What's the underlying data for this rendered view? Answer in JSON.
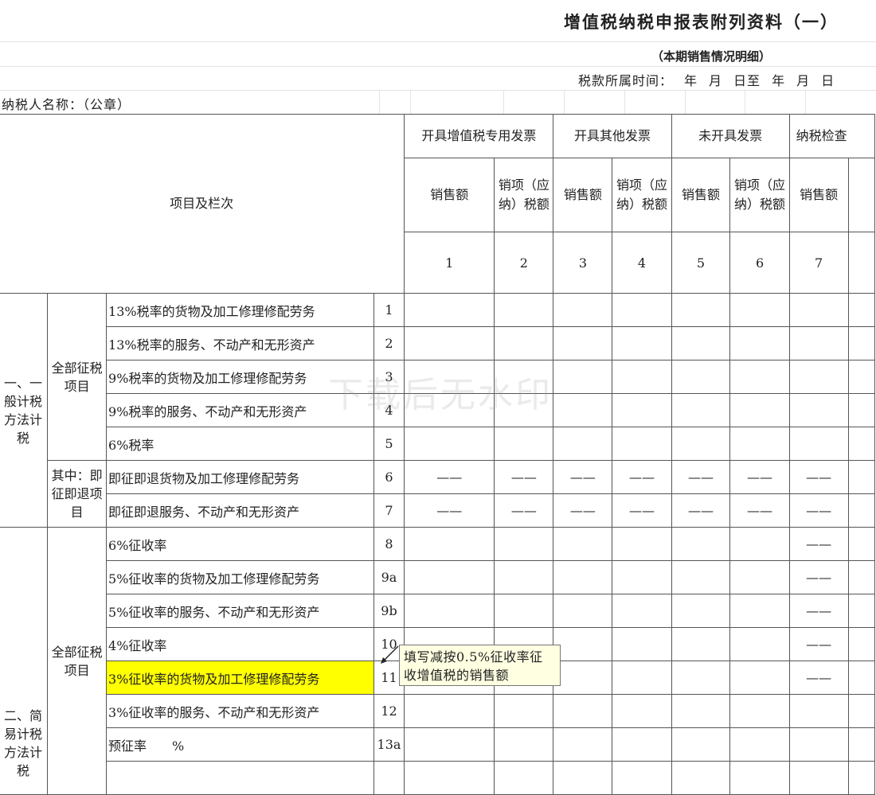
{
  "header": {
    "title": "增值税纳税申报表附列资料（一）",
    "subtitle": "（本期销售情况明细）",
    "period_label": "税款所属时间：",
    "period_parts": [
      "年",
      "月",
      "日至",
      "年",
      "月",
      "日"
    ],
    "taxpayer_label": "纳税人名称：（公章）"
  },
  "table": {
    "project_header": "项目及栏次",
    "groups": [
      "开具增值税专用发票",
      "开具其他发票",
      "未开具发票",
      "纳税检查"
    ],
    "sub_headers": [
      "销售额",
      "销项（应纳）税额",
      "销售额",
      "销项（应纳）税额",
      "销售额",
      "销项（应纳）税额",
      "销售额"
    ],
    "column_numbers": [
      "1",
      "2",
      "3",
      "4",
      "5",
      "6",
      "7"
    ],
    "dash": "——",
    "section1": {
      "label": "一、一般计税方法计税",
      "sub1": "全部征税项目",
      "sub2": "其中：即征即退项目"
    },
    "section2": {
      "label": "二、简易计税方法计税",
      "sub1": "全部征税项目"
    },
    "rows": [
      {
        "item": "13%税率的货物及加工修理修配劳务",
        "line": "1"
      },
      {
        "item": "13%税率的服务、不动产和无形资产",
        "line": "2"
      },
      {
        "item": "9%税率的货物及加工修理修配劳务",
        "line": "3"
      },
      {
        "item": "9%税率的服务、不动产和无形资产",
        "line": "4"
      },
      {
        "item": "6%税率",
        "line": "5"
      },
      {
        "item": "即征即退货物及加工修理修配劳务",
        "line": "6"
      },
      {
        "item": "即征即退服务、不动产和无形资产",
        "line": "7"
      },
      {
        "item": "6%征收率",
        "line": "8"
      },
      {
        "item": "5%征收率的货物及加工修理修配劳务",
        "line": "9a"
      },
      {
        "item": "5%征收率的服务、不动产和无形资产",
        "line": "9b"
      },
      {
        "item": "4%征收率",
        "line": "10"
      },
      {
        "item": "3%征收率的货物及加工修理修配劳务",
        "line": "11"
      },
      {
        "item": "3%征收率的服务、不动产和无形资产",
        "line": "12"
      },
      {
        "item": "预征率　　%",
        "line": "13a"
      }
    ]
  },
  "comment": {
    "text": "填写减按0.5%征收率征收增值税的销售额",
    "highlight_color": "#ffff00",
    "background_color": "#ffffe1"
  },
  "watermark": "下载后无水印"
}
